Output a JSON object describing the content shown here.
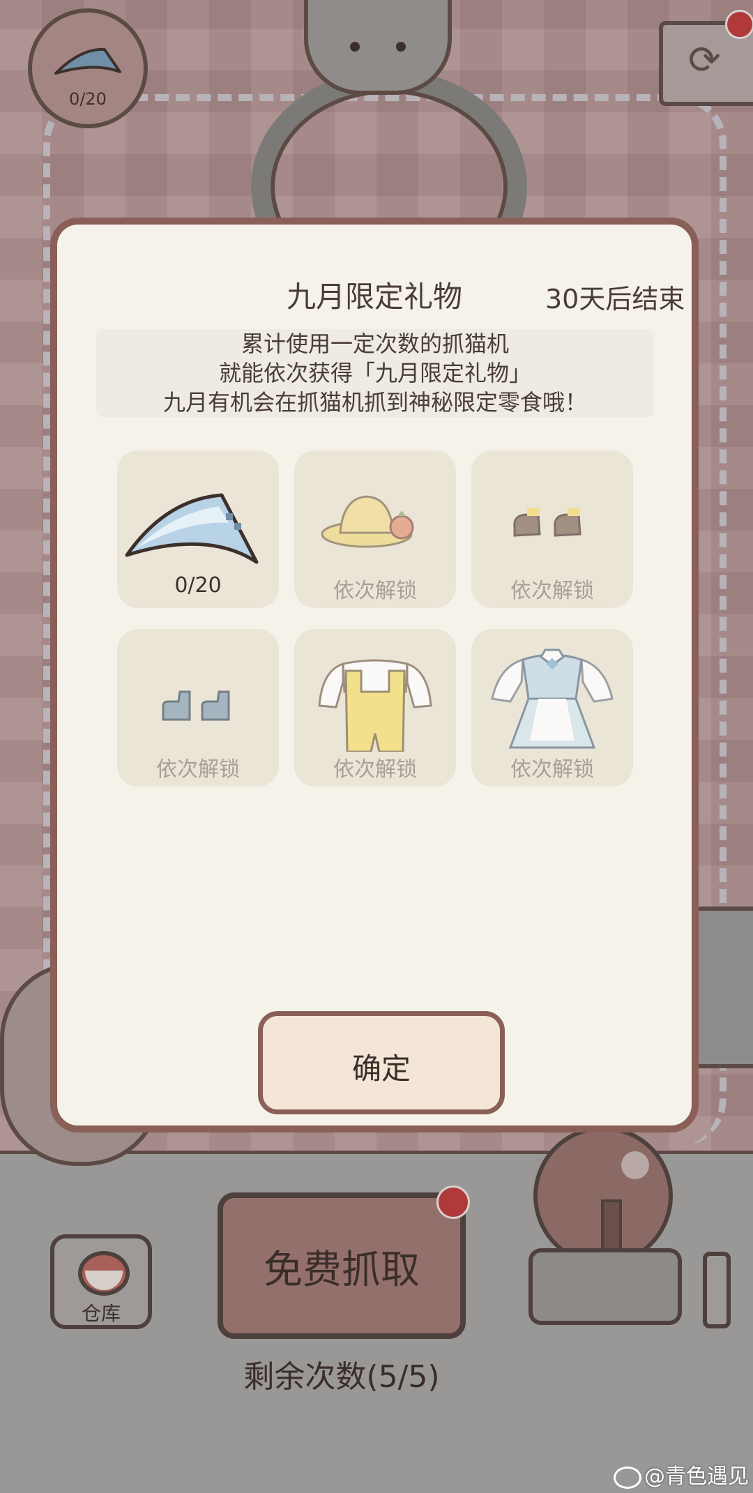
{
  "hud": {
    "progress_label": "0/20"
  },
  "modal": {
    "title": "九月限定礼物",
    "countdown": "30天后结束",
    "description": [
      "累计使用一定次数的抓猫机",
      "就能依次获得「九月限定礼物」",
      "九月有机会在抓猫机抓到神秘限定零食哦！"
    ],
    "rewards": [
      {
        "icon": "blue-feather-blade-icon",
        "label": "0/20",
        "unlocked": true
      },
      {
        "icon": "straw-hat-icon",
        "label": "依次解锁",
        "unlocked": false
      },
      {
        "icon": "brown-shoes-icon",
        "label": "依次解锁",
        "unlocked": false
      },
      {
        "icon": "blue-boots-icon",
        "label": "依次解锁",
        "unlocked": false
      },
      {
        "icon": "yellow-overalls-icon",
        "label": "依次解锁",
        "unlocked": false
      },
      {
        "icon": "blue-maid-dress-icon",
        "label": "依次解锁",
        "unlocked": false
      }
    ],
    "confirm_label": "确定"
  },
  "controls": {
    "warehouse_label": "仓库",
    "free_grab_label": "免费抓取",
    "remaining_label": "剩余次数(5/5)"
  },
  "watermark": "@青色遇见",
  "colors": {
    "modal_border": "#8a5f58",
    "modal_bg": "#f5f2ea",
    "card_bg": "#ebe5d7",
    "notification_dot": "#b0393a",
    "locked_text": "#a89f95"
  }
}
